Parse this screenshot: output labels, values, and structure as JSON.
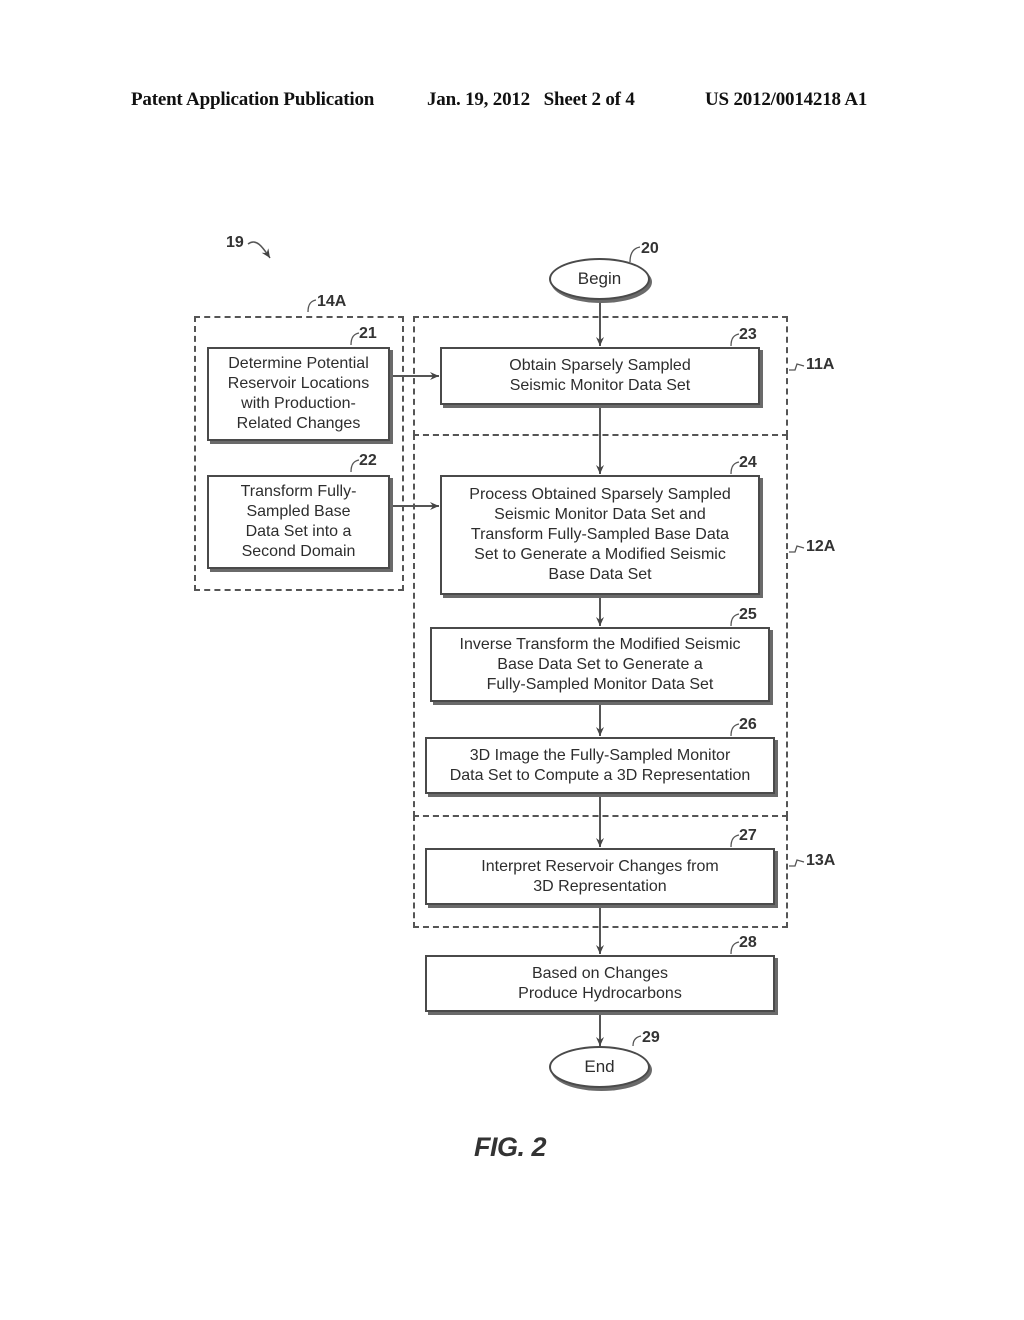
{
  "header": {
    "publication": "Patent Application Publication",
    "date_sheet": "Jan. 19, 2012   Sheet 2 of 4",
    "patent_number": "US 2012/0014218 A1"
  },
  "figure": {
    "label": "FIG. 2",
    "reference": "19"
  },
  "regions": [
    {
      "id": "14A",
      "label": "14A"
    },
    {
      "id": "11A",
      "label": "11A"
    },
    {
      "id": "12A",
      "label": "12A"
    },
    {
      "id": "13A",
      "label": "13A"
    }
  ],
  "nodes": {
    "begin": {
      "ref": "20",
      "text": "Begin"
    },
    "n21": {
      "ref": "21",
      "text": "Determine Potential\nReservoir Locations\nwith Production-\nRelated Changes"
    },
    "n22": {
      "ref": "22",
      "text": "Transform Fully-\nSampled Base\nData Set into a\nSecond Domain"
    },
    "n23": {
      "ref": "23",
      "text": "Obtain Sparsely Sampled\nSeismic Monitor Data Set"
    },
    "n24": {
      "ref": "24",
      "text": "Process Obtained Sparsely Sampled\nSeismic Monitor Data Set and\nTransform Fully-Sampled Base Data\nSet to Generate a Modified Seismic\nBase Data Set"
    },
    "n25": {
      "ref": "25",
      "text": "Inverse Transform the Modified Seismic\nBase Data Set to Generate a\nFully-Sampled Monitor Data Set"
    },
    "n26": {
      "ref": "26",
      "text": "3D Image the Fully-Sampled Monitor\nData Set to Compute a 3D Representation"
    },
    "n27": {
      "ref": "27",
      "text": "Interpret Reservoir Changes from\n3D Representation"
    },
    "n28": {
      "ref": "28",
      "text": "Based on Changes\nProduce Hydrocarbons"
    },
    "end": {
      "ref": "29",
      "text": "End"
    }
  }
}
